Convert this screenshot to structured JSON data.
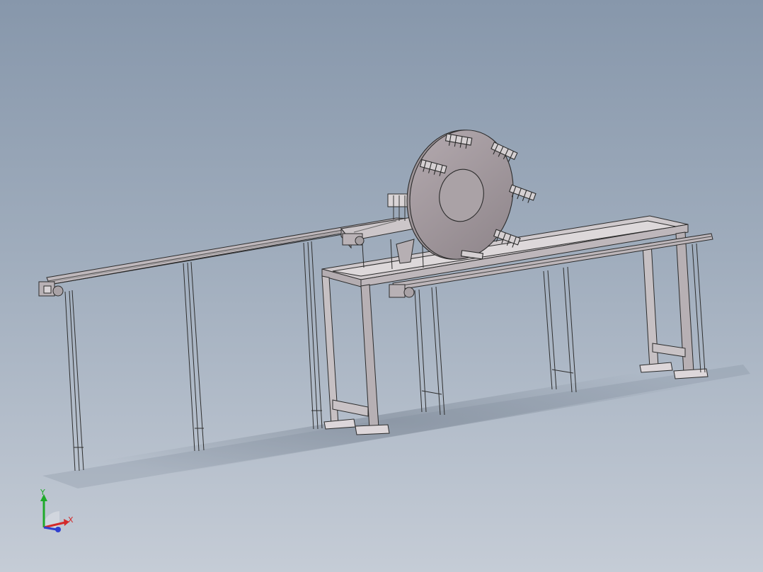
{
  "triad": {
    "y_label": "Y",
    "x_label": "X",
    "colors": {
      "y": "#1faa2a",
      "x": "#d42a2a",
      "z": "#2f3fd0"
    }
  }
}
